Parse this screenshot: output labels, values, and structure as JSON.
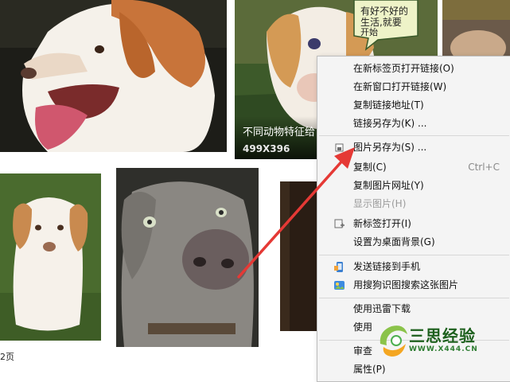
{
  "images": [
    {
      "name": "beagle-pointer-tongue"
    },
    {
      "name": "puppy-with-bubble",
      "bubble_text": "有好不好的生活,就要开始",
      "title": "不同动物特征给",
      "size": "499X396"
    },
    {
      "name": "dog-partial-top-right"
    },
    {
      "name": "spaniel-puppy-grass"
    },
    {
      "name": "weimaraner-nose"
    },
    {
      "name": "dark-photo-partial"
    }
  ],
  "page_fragment": "2页",
  "context_menu": {
    "items": [
      {
        "label": "在新标签页打开链接(O)",
        "shortcut": "",
        "icon": "",
        "disabled": false
      },
      {
        "label": "在新窗口打开链接(W)",
        "shortcut": "",
        "icon": "",
        "disabled": false
      },
      {
        "label": "复制链接地址(T)",
        "shortcut": "",
        "icon": "",
        "disabled": false
      },
      {
        "label": "链接另存为(K) ...",
        "shortcut": "",
        "icon": "",
        "disabled": false
      },
      {
        "label": "图片另存为(S) ...",
        "shortcut": "",
        "icon": "save-image-icon",
        "disabled": false
      },
      {
        "label": "复制(C)",
        "shortcut": "Ctrl+C",
        "icon": "",
        "disabled": false
      },
      {
        "label": "复制图片网址(Y)",
        "shortcut": "",
        "icon": "",
        "disabled": false
      },
      {
        "label": "显示图片(H)",
        "shortcut": "",
        "icon": "",
        "disabled": true
      },
      {
        "label": "新标签打开(I)",
        "shortcut": "",
        "icon": "new-tab-icon",
        "disabled": false
      },
      {
        "label": "设置为桌面背景(G)",
        "shortcut": "",
        "icon": "",
        "disabled": false
      },
      {
        "label": "发送链接到手机",
        "shortcut": "",
        "icon": "phone-icon",
        "disabled": false
      },
      {
        "label": "用搜狗识图搜索这张图片",
        "shortcut": "",
        "icon": "image-search-icon",
        "disabled": false
      },
      {
        "label": "使用迅雷下载",
        "shortcut": "",
        "icon": "",
        "disabled": false
      },
      {
        "label": "使用",
        "shortcut": "",
        "icon": "",
        "disabled": false
      },
      {
        "label": "审查",
        "shortcut": "",
        "icon": "",
        "disabled": false
      },
      {
        "label": "属性(P)",
        "shortcut": "",
        "icon": "",
        "disabled": false
      }
    ]
  },
  "annotation": {
    "color": "#e53935",
    "icon": "arrow"
  },
  "watermark": {
    "text": "三思经验",
    "url": "WWW.X444.CN",
    "color": "#1c5f1c"
  }
}
